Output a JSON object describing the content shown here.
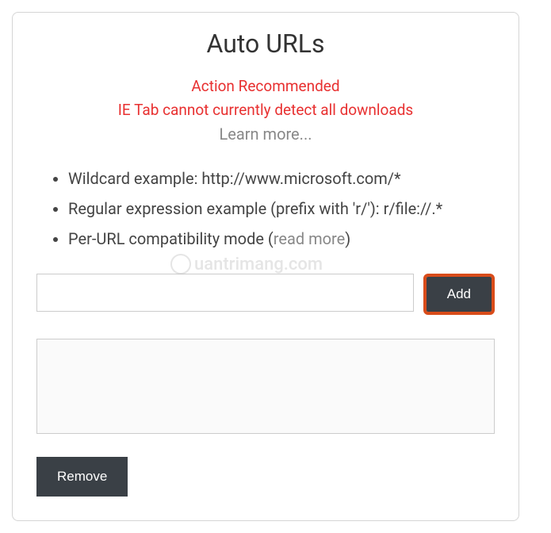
{
  "title": "Auto URLs",
  "warning": {
    "line1": "Action Recommended",
    "line2": "IE Tab cannot currently detect all downloads",
    "learn_more": "Learn more..."
  },
  "examples": {
    "item1": "Wildcard example: http://www.microsoft.com/*",
    "item2": "Regular expression example (prefix with 'r/'): r/file://.*",
    "item3_prefix": "Per-URL compatibility mode (",
    "item3_link": "read more",
    "item3_suffix": ")"
  },
  "input": {
    "value": "",
    "placeholder": ""
  },
  "buttons": {
    "add": "Add",
    "remove": "Remove"
  },
  "url_list": {
    "value": ""
  },
  "watermark": {
    "text": "uantrimang.com"
  }
}
